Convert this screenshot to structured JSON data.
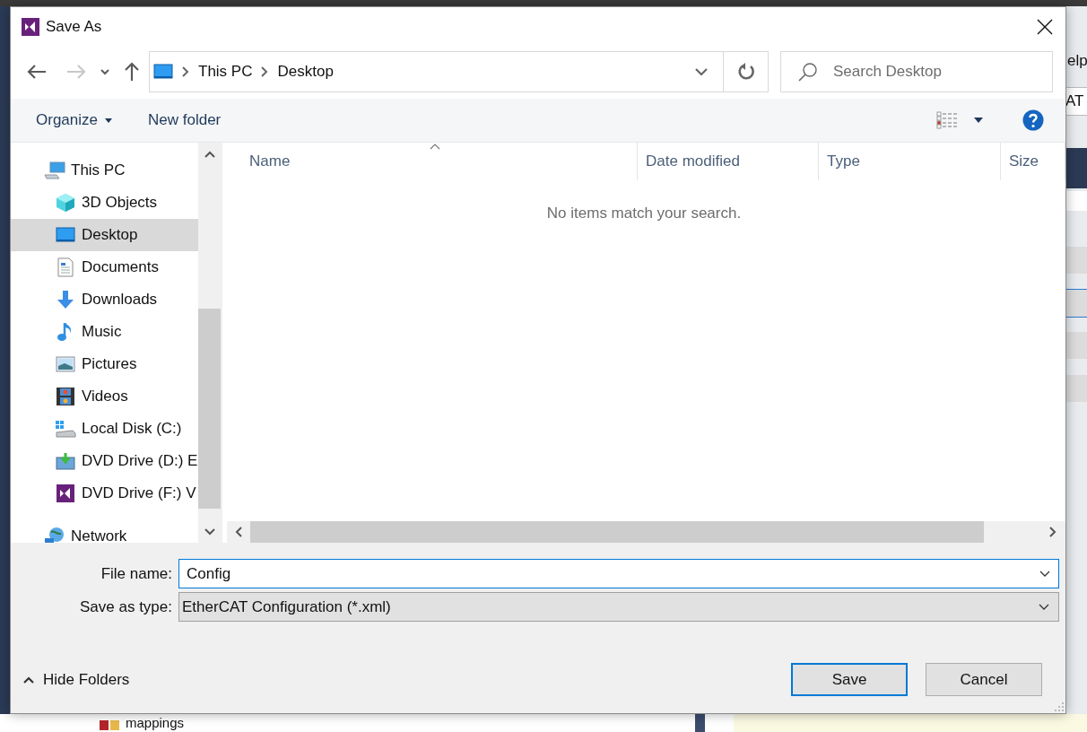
{
  "background": {
    "texts": [
      {
        "text": "elp"
      },
      {
        "text": "AT"
      },
      {
        "text": "mappings"
      }
    ]
  },
  "window": {
    "title": "Save As"
  },
  "navigation": {
    "back_disabled": false,
    "forward_disabled": true,
    "path": [
      "This PC",
      "Desktop"
    ],
    "search": {
      "placeholder": "Search Desktop"
    }
  },
  "toolbar": {
    "items": [
      {
        "label": "Organize",
        "kind": "menu"
      },
      {
        "label": "New folder",
        "kind": "button"
      }
    ]
  },
  "sidebar": {
    "items": [
      {
        "label": "This PC",
        "kind": "pc",
        "selected": false,
        "children": [
          {
            "label": "3D Objects",
            "kind": "cube",
            "selected": false
          },
          {
            "label": "Desktop",
            "kind": "desktop",
            "selected": true
          },
          {
            "label": "Documents",
            "kind": "documents",
            "selected": false
          },
          {
            "label": "Downloads",
            "kind": "downloads",
            "selected": false
          },
          {
            "label": "Music",
            "kind": "music",
            "selected": false
          },
          {
            "label": "Pictures",
            "kind": "pictures",
            "selected": false
          },
          {
            "label": "Videos",
            "kind": "videos",
            "selected": false
          },
          {
            "label": "Local Disk (C:)",
            "kind": "disk",
            "selected": false
          },
          {
            "label": "DVD Drive (D:) E",
            "kind": "dvd",
            "selected": false
          },
          {
            "label": "DVD Drive (F:) V",
            "kind": "vsdvd",
            "selected": false
          }
        ]
      },
      {
        "label": "Network",
        "kind": "network",
        "selected": false
      }
    ]
  },
  "file_list": {
    "columns": [
      {
        "label": "Name",
        "sorted": true
      },
      {
        "label": "Date modified",
        "sorted": false
      },
      {
        "label": "Type",
        "sorted": false
      },
      {
        "label": "Size",
        "sorted": false
      }
    ],
    "empty_message": "No items match your search."
  },
  "form": {
    "fields": [
      {
        "label": "File name:",
        "value": "Config",
        "kind": "input",
        "focused": true
      },
      {
        "label": "Save as type:",
        "value": "EtherCAT Configuration (*.xml)",
        "kind": "combo",
        "focused": false
      }
    ]
  },
  "footer": {
    "toggle": "Hide Folders",
    "buttons": [
      {
        "label": "Save",
        "default": true
      },
      {
        "label": "Cancel",
        "default": false
      }
    ]
  }
}
